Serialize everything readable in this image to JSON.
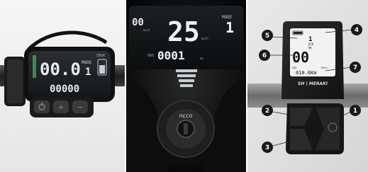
{
  "photos": [
    {
      "name": "left-display-photo",
      "brand_label": "ENGR",
      "speed": "00.0",
      "mode_label": "MODE",
      "mode_value": "1",
      "odometer": "00000",
      "buttons": [
        "power-button",
        "plus-button",
        "minus-button"
      ]
    },
    {
      "name": "center-display-photo",
      "left_readout": "00",
      "left_unit": "km/h",
      "speed": "25",
      "speed_unit": "km/h",
      "mode_label": "MODE",
      "mode_value": "1",
      "odo_label": "ODO",
      "odometer": "0001",
      "odo_unit": "km",
      "ignition_brand": "ncco"
    },
    {
      "name": "right-display-photo",
      "screen_mode_lines": [
        "1",
        "ECO",
        "0%"
      ],
      "speed": "00",
      "odo_label": "ODO",
      "odo_unit": "KM/H",
      "odometer": "010.6Km",
      "brand": "SH | MERAKI",
      "callouts": [
        "1",
        "2",
        "3",
        "4",
        "5",
        "6",
        "7"
      ]
    }
  ]
}
